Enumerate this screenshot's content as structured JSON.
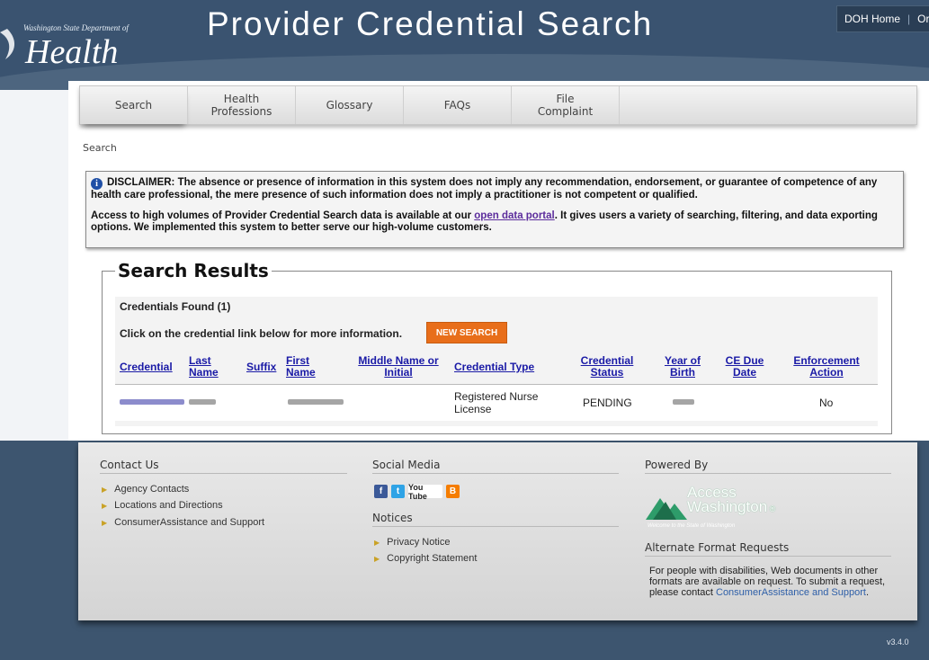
{
  "header": {
    "logo_small": "Washington State Department of",
    "logo_big": "Health",
    "site_title": "Provider Credential Search",
    "links": [
      "DOH Home",
      "Or"
    ]
  },
  "nav": {
    "items": [
      {
        "label": "Search"
      },
      {
        "label": "Health\nProfessions"
      },
      {
        "label": "Glossary"
      },
      {
        "label": "FAQs"
      },
      {
        "label": "File\nComplaint"
      }
    ]
  },
  "breadcrumb": "Search",
  "disclaimer": {
    "p1": "DISCLAIMER: The absence or presence of information in this system does not imply any recommendation, endorsement, or guarantee of competence of any health care professional, the mere presence of such information does not imply a practitioner is not competent or qualified.",
    "p2_before": "Access to high volumes of Provider Credential Search data is available at our ",
    "p2_link": "open data portal",
    "p2_after": ". It gives users a variety of searching, filtering, and data exporting options. We implemented this system to better serve our high-volume customers."
  },
  "results": {
    "title": "Search Results",
    "found": "Credentials Found (1)",
    "click_info": "Click on the credential link below for more information.",
    "new_search": "NEW SEARCH",
    "columns": {
      "credential": "Credential",
      "last_name": "Last\nName",
      "suffix": "Suffix",
      "first_name": "First\nName",
      "middle_name": "Middle Name or\nInitial",
      "credential_type": "Credential Type",
      "credential_status": "Credential\nStatus",
      "year_of_birth": "Year of\nBirth",
      "ce_due_date": "CE Due\nDate",
      "enforcement_action": "Enforcement\nAction"
    },
    "row": {
      "credential_type": "Registered Nurse\nLicense",
      "credential_status": "PENDING",
      "enforcement_action": "No"
    }
  },
  "footer": {
    "contact_title": "Contact Us",
    "contact_links": [
      "Agency Contacts",
      "Locations and Directions",
      "ConsumerAssistance and Support"
    ],
    "social_title": "Social Media",
    "notices_title": "Notices",
    "notices_links": [
      "Privacy Notice",
      "Copyright Statement"
    ],
    "powered_title": "Powered By",
    "aw_line1": "Access",
    "aw_line2": "Washington",
    "aw_sub": "Welcome to the State of Washington",
    "alt_title": "Alternate Format Requests",
    "alt_text": "For people with disabilities, Web documents in other formats are available on request. To submit a request, please contact ",
    "alt_link": "ConsumerAssistance and Support",
    "alt_end": ".",
    "social_icons": [
      "facebook-icon",
      "twitter-icon",
      "youtube-icon",
      "blogger-icon"
    ],
    "youtube_label": "You Tube"
  },
  "version": "v3.4.0",
  "colors": {
    "accent_orange": "#e86e1a",
    "header_blue": "#3a5370",
    "link_blue": "#1a1aa6"
  }
}
